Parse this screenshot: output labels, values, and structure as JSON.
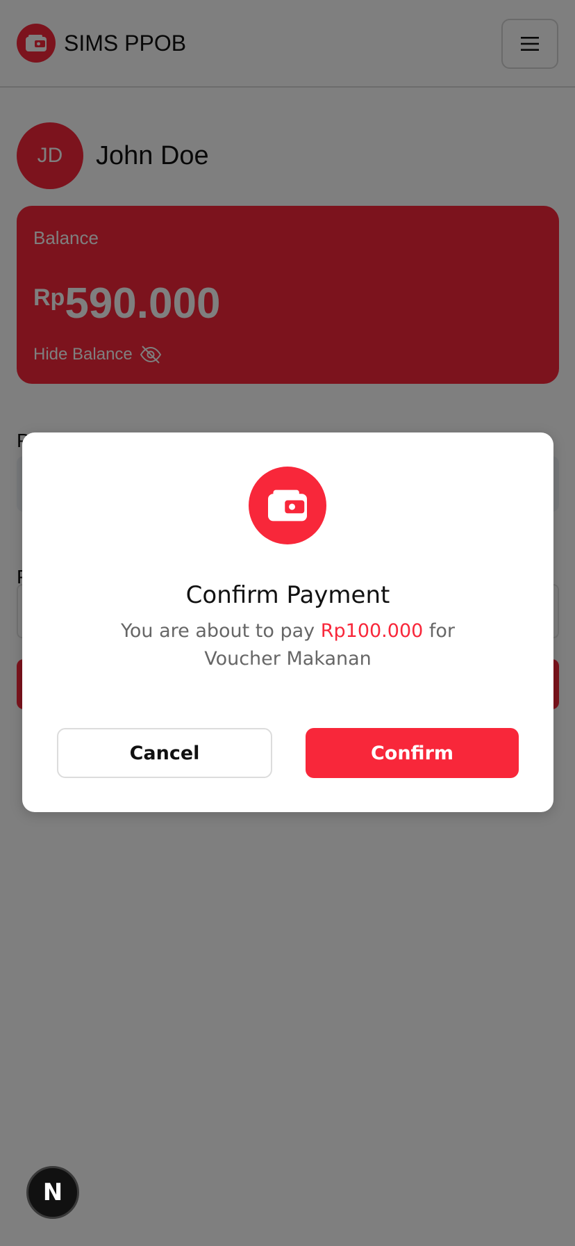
{
  "header": {
    "app_title": "SIMS PPOB",
    "logo_icon": "wallet-icon",
    "menu_icon": "hamburger-menu-icon"
  },
  "profile": {
    "initials": "JD",
    "name": "John Doe"
  },
  "balance_card": {
    "label": "Balance",
    "currency": "Rp",
    "amount": "590.000",
    "toggle_label": "Hide Balance",
    "toggle_icon": "eye-off-icon"
  },
  "modal": {
    "icon": "wallet-icon",
    "title": "Confirm Payment",
    "message_prefix": "You are about to pay ",
    "message_amount": "Rp100.000",
    "message_suffix": " for Voucher Makanan",
    "cancel_label": "Cancel",
    "confirm_label": "Confirm"
  },
  "floating_badge": {
    "label": "N"
  },
  "colors": {
    "brand_red": "#f8273a",
    "overlay": "rgba(0,0,0,0.5)",
    "muted_text": "#666666"
  }
}
